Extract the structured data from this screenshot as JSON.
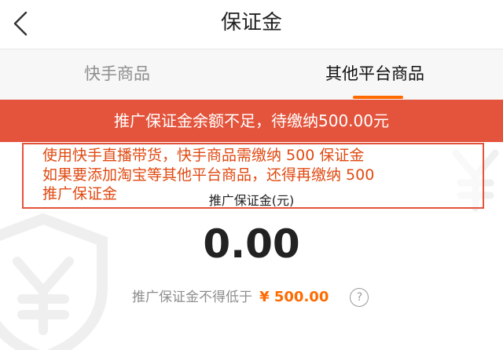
{
  "header": {
    "title": "保证金",
    "back_icon": "chevron-left-icon"
  },
  "tabs": [
    {
      "label": "快手商品",
      "active": false
    },
    {
      "label": "其他平台商品",
      "active": true
    }
  ],
  "banner": {
    "text": "推广保证金余额不足，待缴纳500.00元",
    "color": "#e4543c"
  },
  "annotation": {
    "line1": "使用快手直播带货，快手商品需缴纳 500 保证金",
    "line2": "如果要添加淘宝等其他平台商品，还得再缴纳 500",
    "line3": "推广保证金",
    "color": "#e04a12"
  },
  "deposit": {
    "label": "推广保证金(元)",
    "amount": "0.00",
    "min_text": "推广保证金不得低于",
    "min_amount": "¥ 500.00",
    "help_icon": "question-circle-icon",
    "help_glyph": "?"
  },
  "colors": {
    "accent": "#ff6a00",
    "banner": "#e4543c"
  }
}
